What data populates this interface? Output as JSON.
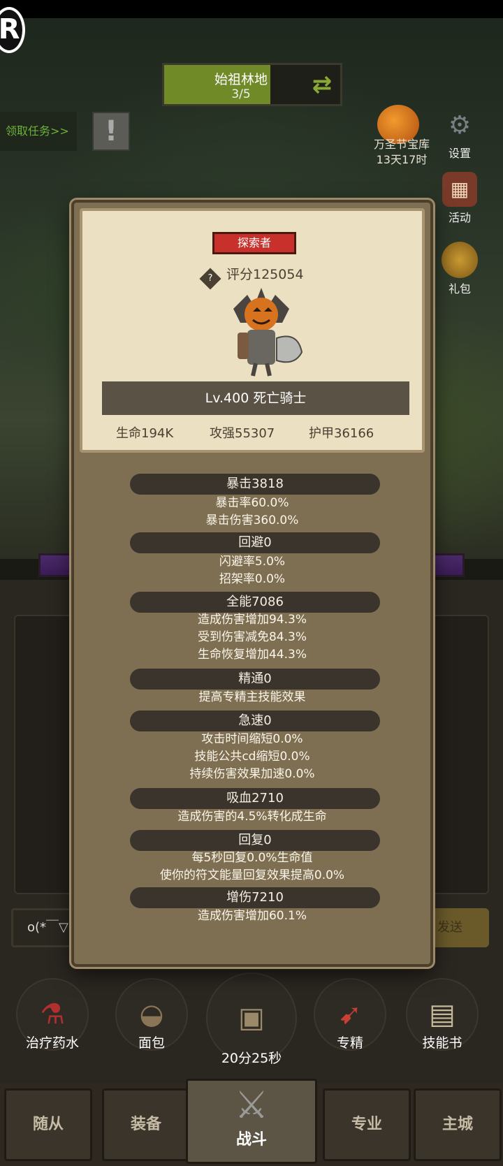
{
  "hud": {
    "map_name": "始祖林地",
    "map_progress": "3/5",
    "quest_button": "领取任务>>",
    "alert": "!",
    "event_text_1": "万圣节宝库",
    "event_text_2": "13天17时",
    "side_icons": [
      {
        "label": "设置",
        "icon": "gear-icon"
      },
      {
        "label": "活动",
        "icon": "calendar-icon"
      },
      {
        "label": "礼包",
        "icon": "gift-icon"
      }
    ]
  },
  "hero_card": {
    "rank": "探索者",
    "score": "评分125054",
    "score_icon": "?",
    "name": "Lv.400 死亡骑士",
    "hp": "生命194K",
    "attack": "攻强55307",
    "armor": "护甲36166"
  },
  "sections": [
    {
      "header": "暴击3818",
      "lines": [
        "暴击率60.0%",
        "暴击伤害360.0%"
      ]
    },
    {
      "header": "回避0",
      "lines": [
        "闪避率5.0%",
        "招架率0.0%"
      ]
    },
    {
      "header": "全能7086",
      "lines": [
        "造成伤害增加94.3%",
        "受到伤害减免84.3%",
        "生命恢复增加44.3%"
      ]
    },
    {
      "header": "精通0",
      "lines": [
        "提高专精主技能效果"
      ]
    },
    {
      "header": "急速0",
      "lines": [
        "攻击时间缩短0.0%",
        "技能公共cd缩短0.0%",
        "持续伤害效果加速0.0%"
      ]
    },
    {
      "header": "吸血2710",
      "lines": [
        "造成伤害的4.5%转化成生命"
      ]
    },
    {
      "header": "回复0",
      "lines": [
        "每5秒回复0.0%生命值",
        "使你的符文能量回复效果提高0.0%"
      ]
    },
    {
      "header": "增伤7210",
      "lines": [
        "造成伤害增加60.1%"
      ]
    }
  ],
  "chat": {
    "text": "o(*￣▽",
    "send": "发送"
  },
  "slots": [
    {
      "label": "治疗药水",
      "icon": "potion-icon"
    },
    {
      "label": "面包",
      "icon": "bread-icon"
    },
    {
      "label": "20分25秒",
      "icon": "chest-icon"
    },
    {
      "label": "专精",
      "icon": "specialization-icon"
    },
    {
      "label": "技能书",
      "icon": "skill-book-icon"
    }
  ],
  "nav": {
    "followers": "随从",
    "equipment": "装备",
    "battle": "战斗",
    "profession": "专业",
    "main_city": "主城"
  }
}
